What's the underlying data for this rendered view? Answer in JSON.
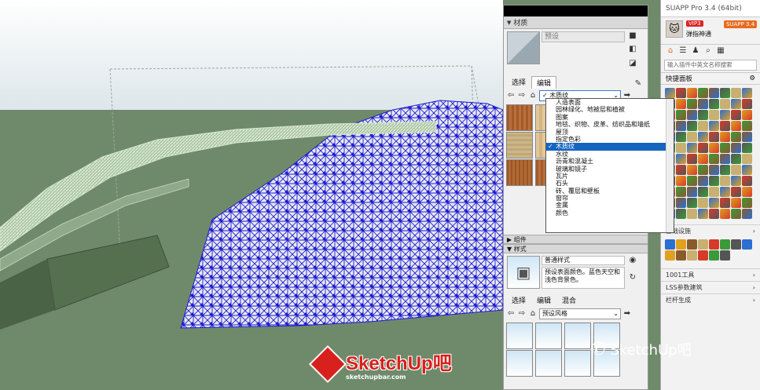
{
  "material_panel": {
    "title": "材质",
    "material_name": "预设",
    "tabs": [
      "选择",
      "编辑"
    ],
    "library_value": "木质纹",
    "library_options": [
      "人造表面",
      "园林绿化、地被层和植被",
      "图案",
      "地毯、织物、皮革、纺织品和墙纸",
      "屋顶",
      "指定色彩",
      "木质纹",
      "水纹",
      "沥青和混凝土",
      "玻璃和镜子",
      "瓦片",
      "石头",
      "砖、覆层和壁板",
      "窗帘",
      "金属",
      "颜色"
    ],
    "selected_option": "木质纹",
    "components_title": "组件",
    "styles_title": "样式",
    "style_name": "普通样式",
    "style_desc": "预设表面颜色。蓝色天空和浅色背景色。",
    "style_tabs": [
      "选择",
      "编辑",
      "混合"
    ],
    "style_dropdown": "预设风格"
  },
  "suapp": {
    "window_title": "SUAPP Pro 3.4 (64bit)",
    "vip_badge": "VIP3",
    "username": "弹指神通",
    "version_badge": "SUAPP 3.4",
    "search_placeholder": "输入插件中英文名称搜索",
    "quick_panel": "快捷面板",
    "sections": [
      "基础设施",
      "1001工具",
      "LSS参数建筑",
      "栏杆生成"
    ]
  },
  "watermark": {
    "logo_text": "SketchUp吧",
    "logo_url_text": "sketchupbar.com",
    "wechat_text": "SketchUp吧"
  },
  "colors": {
    "mesh_blue": "#1a1acc",
    "ground": "#6f8a6b",
    "sky": "#e8eef0",
    "select_blue": "#1565c0",
    "suapp_orange": "#e96a1f"
  }
}
